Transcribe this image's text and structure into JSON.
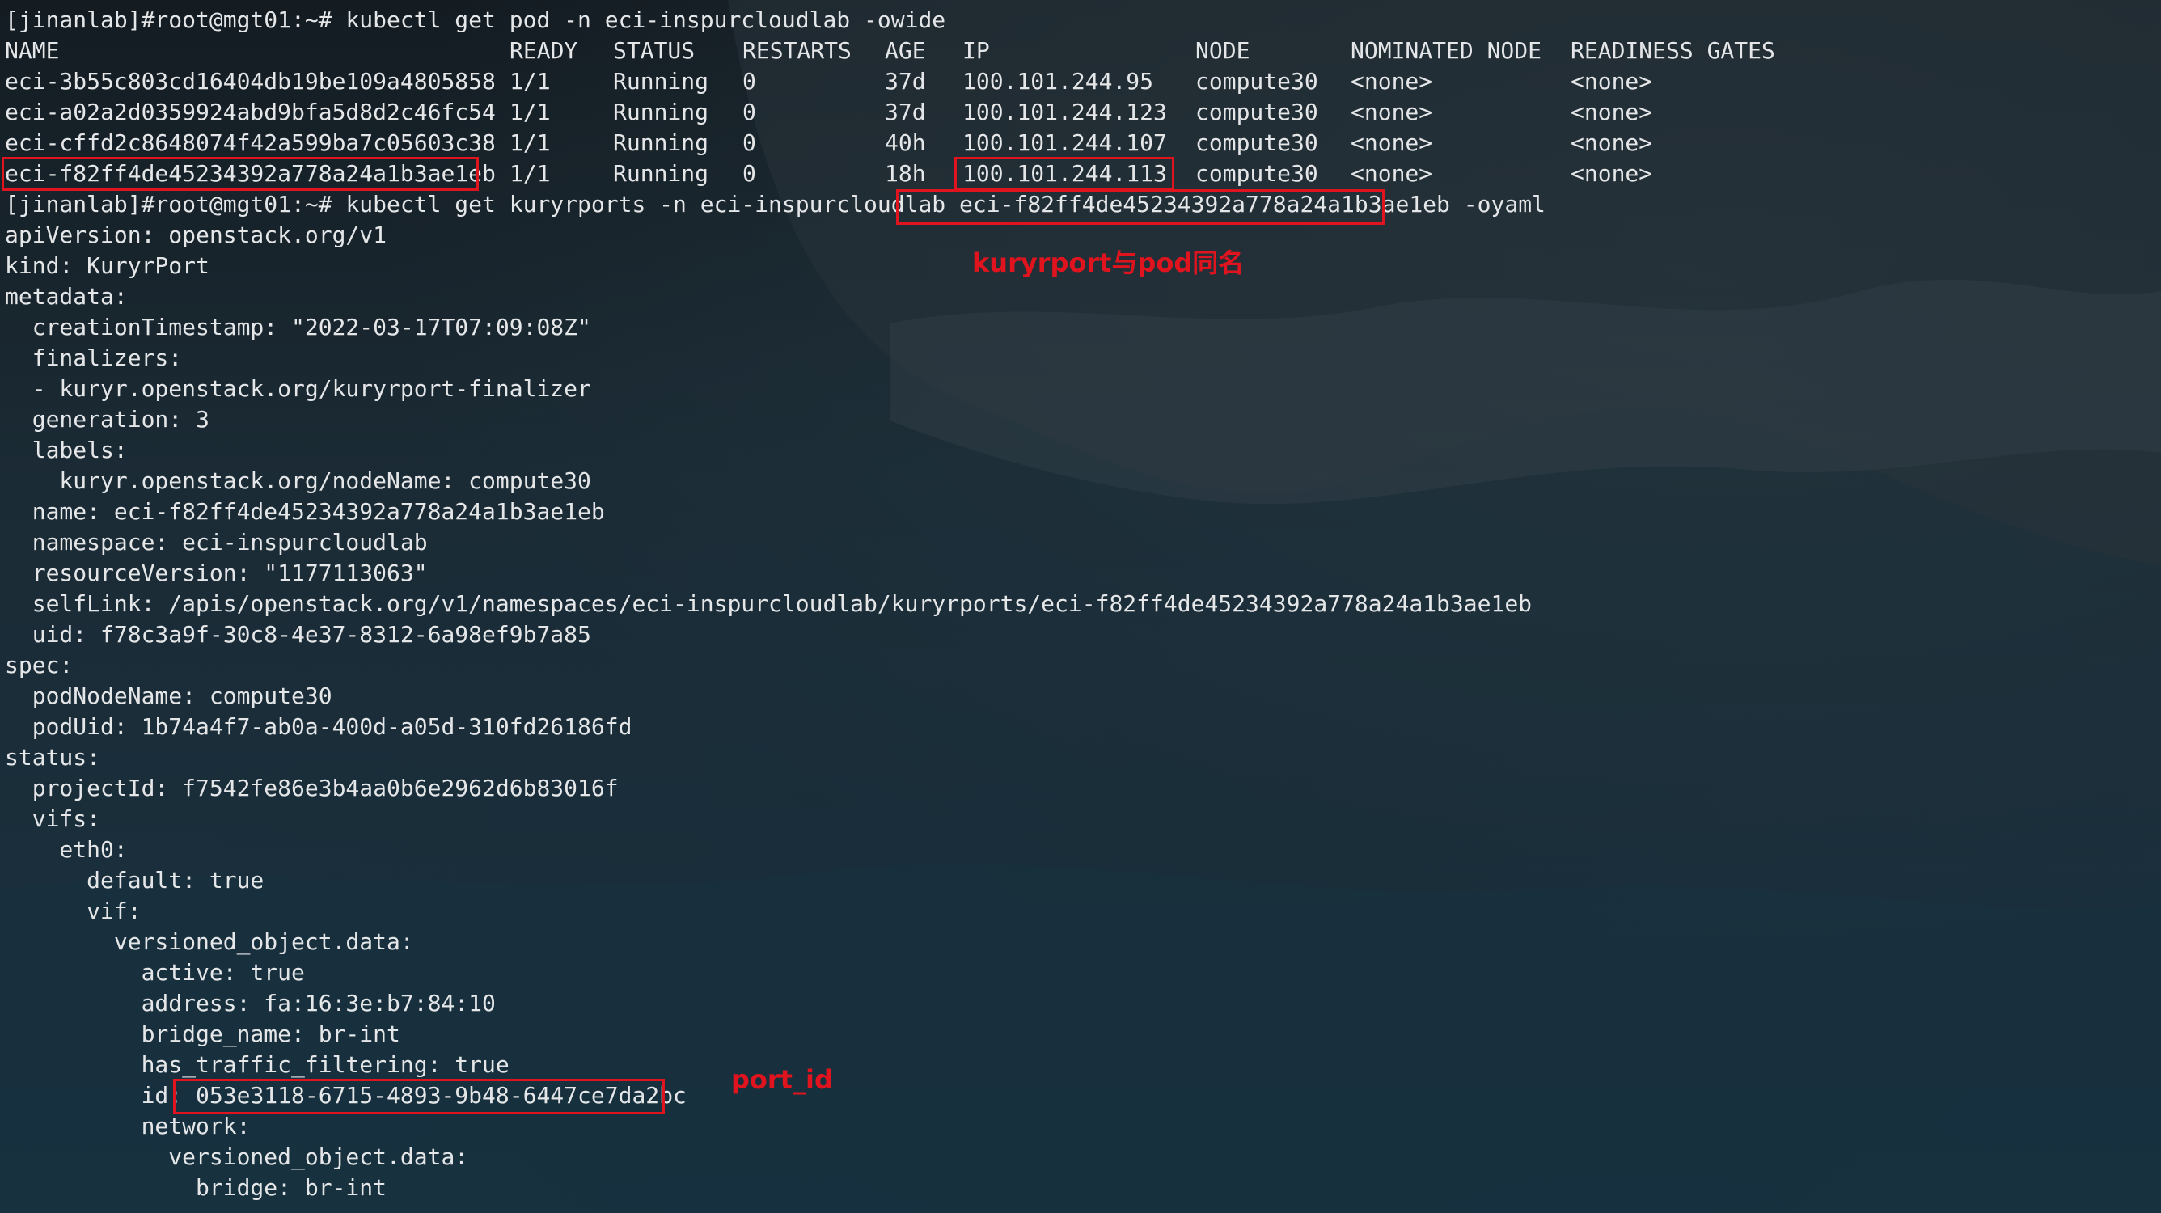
{
  "terminal": {
    "prompt_user": "[jinanlab]#root@mgt01:~#",
    "cmd1": "kubectl get pod -n eci-inspurcloudlab -owide",
    "cmd2_prefix": "kubectl get kuryrports -n eci-inspurcloudlab",
    "cmd2_name": "eci-f82ff4de45234392a778a24a1b3ae1eb",
    "cmd2_suffix": "-oyaml"
  },
  "pod_table": {
    "headers": [
      "NAME",
      "READY",
      "STATUS",
      "RESTARTS",
      "AGE",
      "IP",
      "NODE",
      "NOMINATED NODE",
      "READINESS GATES"
    ],
    "rows": [
      [
        "eci-3b55c803cd16404db19be109a4805858",
        "1/1",
        "Running",
        "0",
        "37d",
        "100.101.244.95",
        "compute30",
        "<none>",
        "<none>"
      ],
      [
        "eci-a02a2d0359924abd9bfa5d8d2c46fc54",
        "1/1",
        "Running",
        "0",
        "37d",
        "100.101.244.123",
        "compute30",
        "<none>",
        "<none>"
      ],
      [
        "eci-cffd2c8648074f42a599ba7c05603c38",
        "1/1",
        "Running",
        "0",
        "40h",
        "100.101.244.107",
        "compute30",
        "<none>",
        "<none>"
      ],
      [
        "eci-f82ff4de45234392a778a24a1b3ae1eb",
        "1/1",
        "Running",
        "0",
        "18h",
        "100.101.244.113",
        "compute30",
        "<none>",
        "<none>"
      ]
    ]
  },
  "yaml": {
    "l01": "apiVersion: openstack.org/v1",
    "l02": "kind: KuryrPort",
    "l03": "metadata:",
    "l04": "  creationTimestamp: \"2022-03-17T07:09:08Z\"",
    "l05": "  finalizers:",
    "l06": "  - kuryr.openstack.org/kuryrport-finalizer",
    "l07": "  generation: 3",
    "l08": "  labels:",
    "l09": "    kuryr.openstack.org/nodeName: compute30",
    "l10": "  name: eci-f82ff4de45234392a778a24a1b3ae1eb",
    "l11": "  namespace: eci-inspurcloudlab",
    "l12": "  resourceVersion: \"1177113063\"",
    "l13": "  selfLink: /apis/openstack.org/v1/namespaces/eci-inspurcloudlab/kuryrports/eci-f82ff4de45234392a778a24a1b3ae1eb",
    "l14": "  uid: f78c3a9f-30c8-4e37-8312-6a98ef9b7a85",
    "l15": "spec:",
    "l16": "  podNodeName: compute30",
    "l17": "  podUid: 1b74a4f7-ab0a-400d-a05d-310fd26186fd",
    "l18": "status:",
    "l19": "  projectId: f7542fe86e3b4aa0b6e2962d6b83016f",
    "l20": "  vifs:",
    "l21": "    eth0:",
    "l22": "      default: true",
    "l23": "      vif:",
    "l24": "        versioned_object.data:",
    "l25": "          active: true",
    "l26": "          address: fa:16:3e:b7:84:10",
    "l27": "          bridge_name: br-int",
    "l28": "          has_traffic_filtering: true",
    "l29_key": "          id:",
    "l29_val": "053e3118-6715-4893-9b48-6447ce7da2bc",
    "l30": "          network:",
    "l31": "            versioned_object.data:",
    "l32": "              bridge: br-int"
  },
  "annotations": {
    "kuryrport_note": "kuryrport与pod同名",
    "port_id_note": "port_id",
    "color": "#e0141e"
  }
}
